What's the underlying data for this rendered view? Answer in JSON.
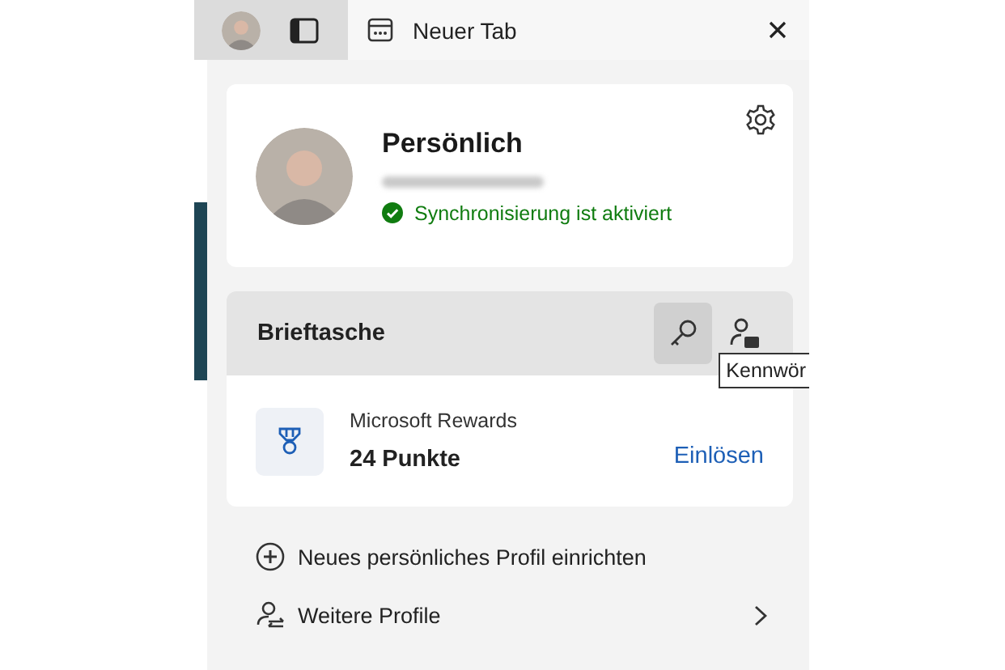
{
  "tab_bar": {
    "tab": {
      "title": "Neuer Tab"
    }
  },
  "profile": {
    "name": "Persönlich",
    "sync_status": "Synchronisierung ist aktiviert"
  },
  "wallet": {
    "title": "Brieftasche",
    "actions": [
      {
        "kind": "key",
        "selected": true
      },
      {
        "kind": "person-card",
        "selected": false
      }
    ],
    "tooltip": "Kennwör"
  },
  "rewards": {
    "title": "Microsoft Rewards",
    "points": "24 Punkte",
    "action": "Einlösen"
  },
  "menu_items": [
    {
      "kind": "add",
      "label": "Neues persönliches Profil einrichten",
      "chevron": false
    },
    {
      "kind": "profiles",
      "label": "Weitere Profile",
      "chevron": true
    }
  ]
}
